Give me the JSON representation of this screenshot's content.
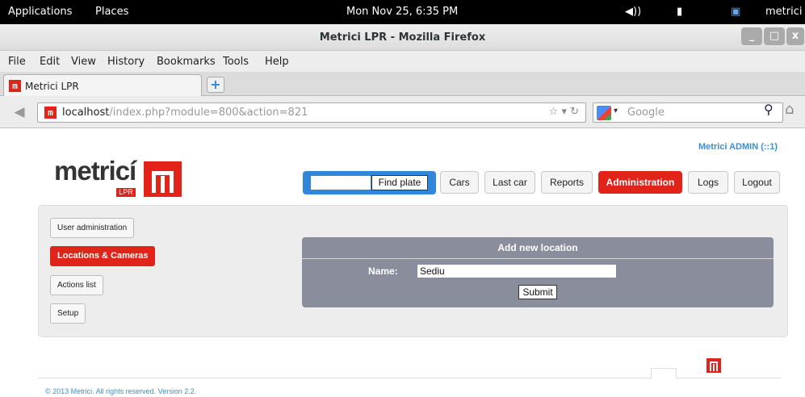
{
  "system": {
    "applications": "Applications",
    "places": "Places",
    "clock": "Mon Nov 25,  6:35 PM",
    "user": "metrici"
  },
  "window": {
    "title": "Metrici LPR - Mozilla Firefox",
    "min": "_",
    "max": "□",
    "close": "x"
  },
  "menu": {
    "file": "File",
    "edit": "Edit",
    "view": "View",
    "history": "History",
    "bookmarks": "Bookmarks",
    "tools": "Tools",
    "help": "Help"
  },
  "tab": {
    "label": "Metrici LPR",
    "favicon": "m",
    "new_tab": "+"
  },
  "address": {
    "host": "localhost",
    "path": "/index.php?module=800&action=821",
    "search_placeholder": "Google"
  },
  "header": {
    "logo_text": "metricí",
    "logo_sub": "LPR",
    "user": "Metrici ADMIN (::1)"
  },
  "topnav": {
    "find_plate": "Find plate",
    "cars": "Cars",
    "last_car": "Last car",
    "reports": "Reports",
    "administration": "Administration",
    "logs": "Logs",
    "logout": "Logout"
  },
  "sidebar": {
    "user_admin": "User administration",
    "locations": "Locations & Cameras",
    "actions": "Actions list",
    "setup": "Setup"
  },
  "form": {
    "title": "Add new location",
    "name_label": "Name:",
    "name_value": "Sediu",
    "submit": "Submit"
  },
  "footer": {
    "copyright": "© 2013 Metrici. All rights reserved. Version 2.2."
  },
  "colors": {
    "brand_red": "#e2231a",
    "link_blue": "#3a8fd8",
    "form_bg": "#8a8e9c",
    "find_blue": "#2f86da"
  }
}
